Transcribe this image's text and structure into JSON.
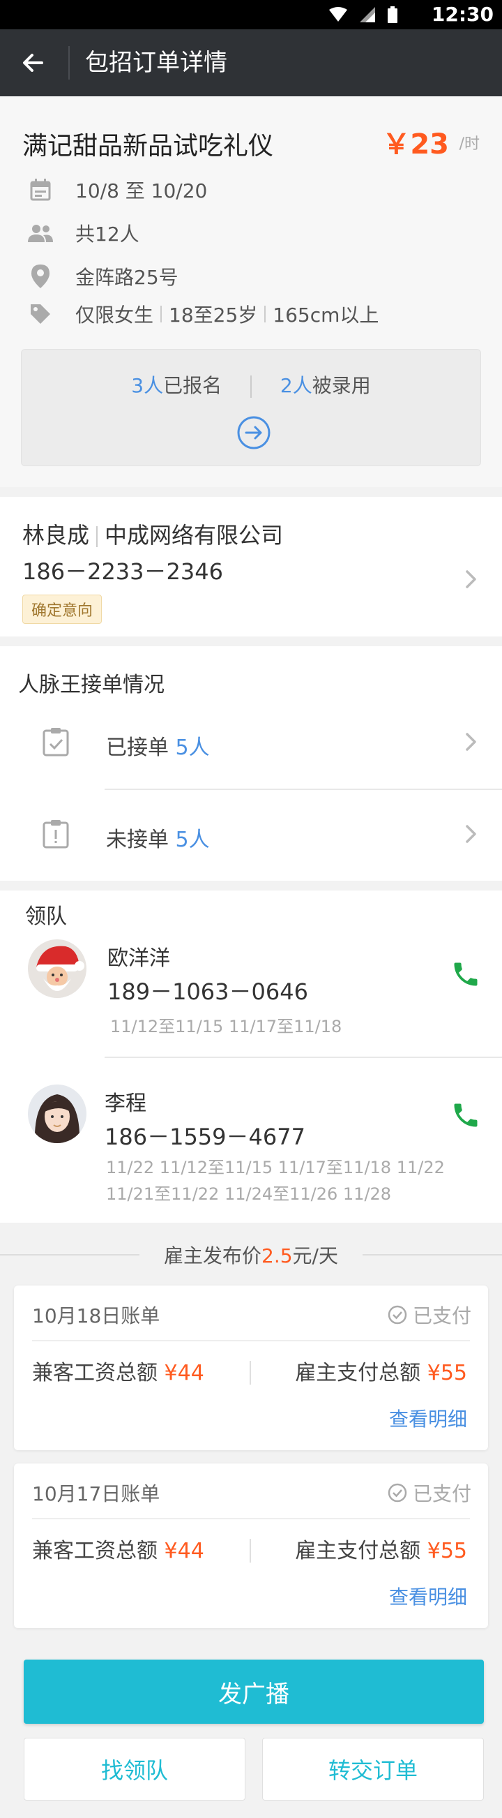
{
  "status_bar": {
    "time": "12:30"
  },
  "app_bar": {
    "title": "包招订单详情"
  },
  "job": {
    "title": "满记甜品新品试吃礼仪",
    "price": "￥23",
    "price_unit": "/时",
    "date_range": "10/8 至 10/20",
    "headcount": "共12人",
    "address": "金阵路25号",
    "requirements": [
      "仅限女生",
      "18至25岁",
      "165cm以上"
    ]
  },
  "signup": {
    "signed_count": "3人",
    "signed_label": "已报名",
    "hired_count": "2人",
    "hired_label": "被录用"
  },
  "employer": {
    "name": "林良成",
    "company": "中成网络有限公司",
    "phone": "186－2233－2346",
    "badge": "确定意向"
  },
  "network": {
    "heading": "人脉王接单情况",
    "accepted_label": "已接单",
    "accepted_count": "5人",
    "unaccepted_label": "未接单",
    "unaccepted_count": "5人"
  },
  "leaders": {
    "heading": "领队",
    "items": [
      {
        "name": "欧洋洋",
        "phone": "189－1063－0646",
        "dates": "11/12至11/15   11/17至11/18"
      },
      {
        "name": "李程",
        "phone": "186－1559－4677",
        "dates": "11/22   11/12至11/15  11/17至11/18   11/22   11/21至11/22   11/24至11/26   11/28"
      }
    ]
  },
  "publish_price": {
    "prefix": "雇主发布价",
    "value": "2.5",
    "suffix": "元/天"
  },
  "bills": [
    {
      "date": "10月18日账单",
      "status": "已支付",
      "wage_label": "兼客工资总额",
      "wage_amount": "¥44",
      "pay_label": "雇主支付总额",
      "pay_amount": "¥55",
      "detail_link": "查看明细"
    },
    {
      "date": "10月17日账单",
      "status": "已支付",
      "wage_label": "兼客工资总额",
      "wage_amount": "¥44",
      "pay_label": "雇主支付总额",
      "pay_amount": "¥55",
      "detail_link": "查看明细"
    }
  ],
  "actions": {
    "broadcast": "发广播",
    "find_leader": "找领队",
    "transfer_order": "转交订单"
  },
  "colors": {
    "accent": "#1fbcd3",
    "price": "#ff5a1f",
    "link": "#4a90e2",
    "call_icon": "#1fa84a",
    "app_bar": "#2f3236"
  }
}
